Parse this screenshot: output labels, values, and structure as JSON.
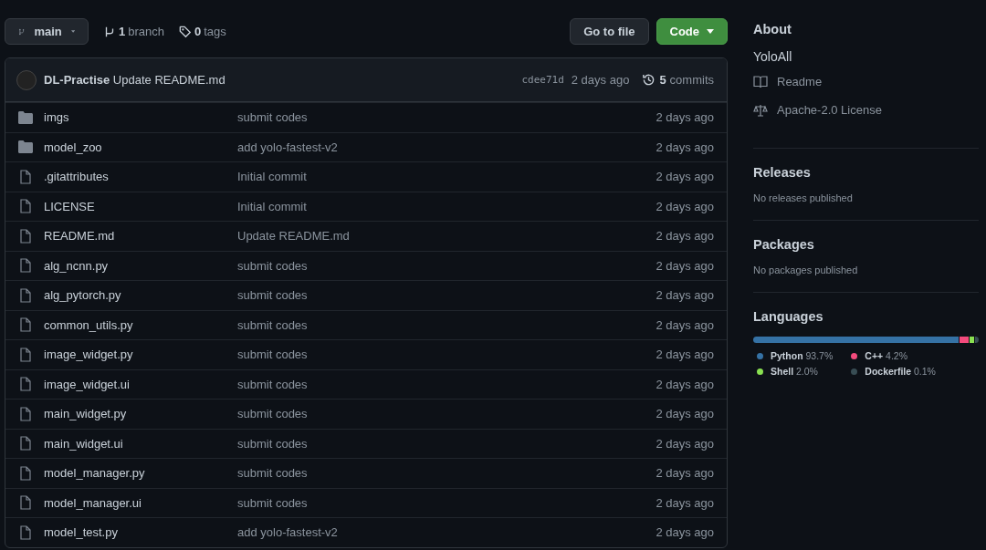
{
  "branch_button": {
    "label": "main"
  },
  "branch_count": {
    "count": "1",
    "label": "branch"
  },
  "tag_count": {
    "count": "0",
    "label": "tags"
  },
  "goto_file_button": {
    "label": "Go to file"
  },
  "code_button": {
    "label": "Code"
  },
  "latest_commit": {
    "author": "DL-Practise",
    "message": "Update README.md",
    "hash": "cdee71d",
    "time": "2 days ago",
    "commit_count": "5",
    "commit_label": "commits"
  },
  "files": [
    {
      "kind": "folder",
      "name": "imgs",
      "message": "submit codes",
      "time": "2 days ago"
    },
    {
      "kind": "folder",
      "name": "model_zoo",
      "message": "add yolo-fastest-v2",
      "time": "2 days ago"
    },
    {
      "kind": "file",
      "name": ".gitattributes",
      "message": "Initial commit",
      "time": "2 days ago"
    },
    {
      "kind": "file",
      "name": "LICENSE",
      "message": "Initial commit",
      "time": "2 days ago"
    },
    {
      "kind": "file",
      "name": "README.md",
      "message": "Update README.md",
      "time": "2 days ago"
    },
    {
      "kind": "file",
      "name": "alg_ncnn.py",
      "message": "submit codes",
      "time": "2 days ago"
    },
    {
      "kind": "file",
      "name": "alg_pytorch.py",
      "message": "submit codes",
      "time": "2 days ago"
    },
    {
      "kind": "file",
      "name": "common_utils.py",
      "message": "submit codes",
      "time": "2 days ago"
    },
    {
      "kind": "file",
      "name": "image_widget.py",
      "message": "submit codes",
      "time": "2 days ago"
    },
    {
      "kind": "file",
      "name": "image_widget.ui",
      "message": "submit codes",
      "time": "2 days ago"
    },
    {
      "kind": "file",
      "name": "main_widget.py",
      "message": "submit codes",
      "time": "2 days ago"
    },
    {
      "kind": "file",
      "name": "main_widget.ui",
      "message": "submit codes",
      "time": "2 days ago"
    },
    {
      "kind": "file",
      "name": "model_manager.py",
      "message": "submit codes",
      "time": "2 days ago"
    },
    {
      "kind": "file",
      "name": "model_manager.ui",
      "message": "submit codes",
      "time": "2 days ago"
    },
    {
      "kind": "file",
      "name": "model_test.py",
      "message": "add yolo-fastest-v2",
      "time": "2 days ago"
    }
  ],
  "about": {
    "title": "About",
    "description": "YoloAll",
    "links": [
      {
        "kind": "readme",
        "label": "Readme"
      },
      {
        "kind": "license",
        "label": "Apache-2.0 License"
      }
    ]
  },
  "releases": {
    "title": "Releases",
    "note": "No releases published"
  },
  "packages": {
    "title": "Packages",
    "note": "No packages published"
  },
  "languages": {
    "title": "Languages",
    "items": [
      {
        "name": "Python",
        "percent": "93.7%",
        "color": "#3572a5"
      },
      {
        "name": "C++",
        "percent": "4.2%",
        "color": "#f34b7d"
      },
      {
        "name": "Shell",
        "percent": "2.0%",
        "color": "#89e051"
      },
      {
        "name": "Dockerfile",
        "percent": "0.1%",
        "color": "#384d54"
      }
    ]
  }
}
